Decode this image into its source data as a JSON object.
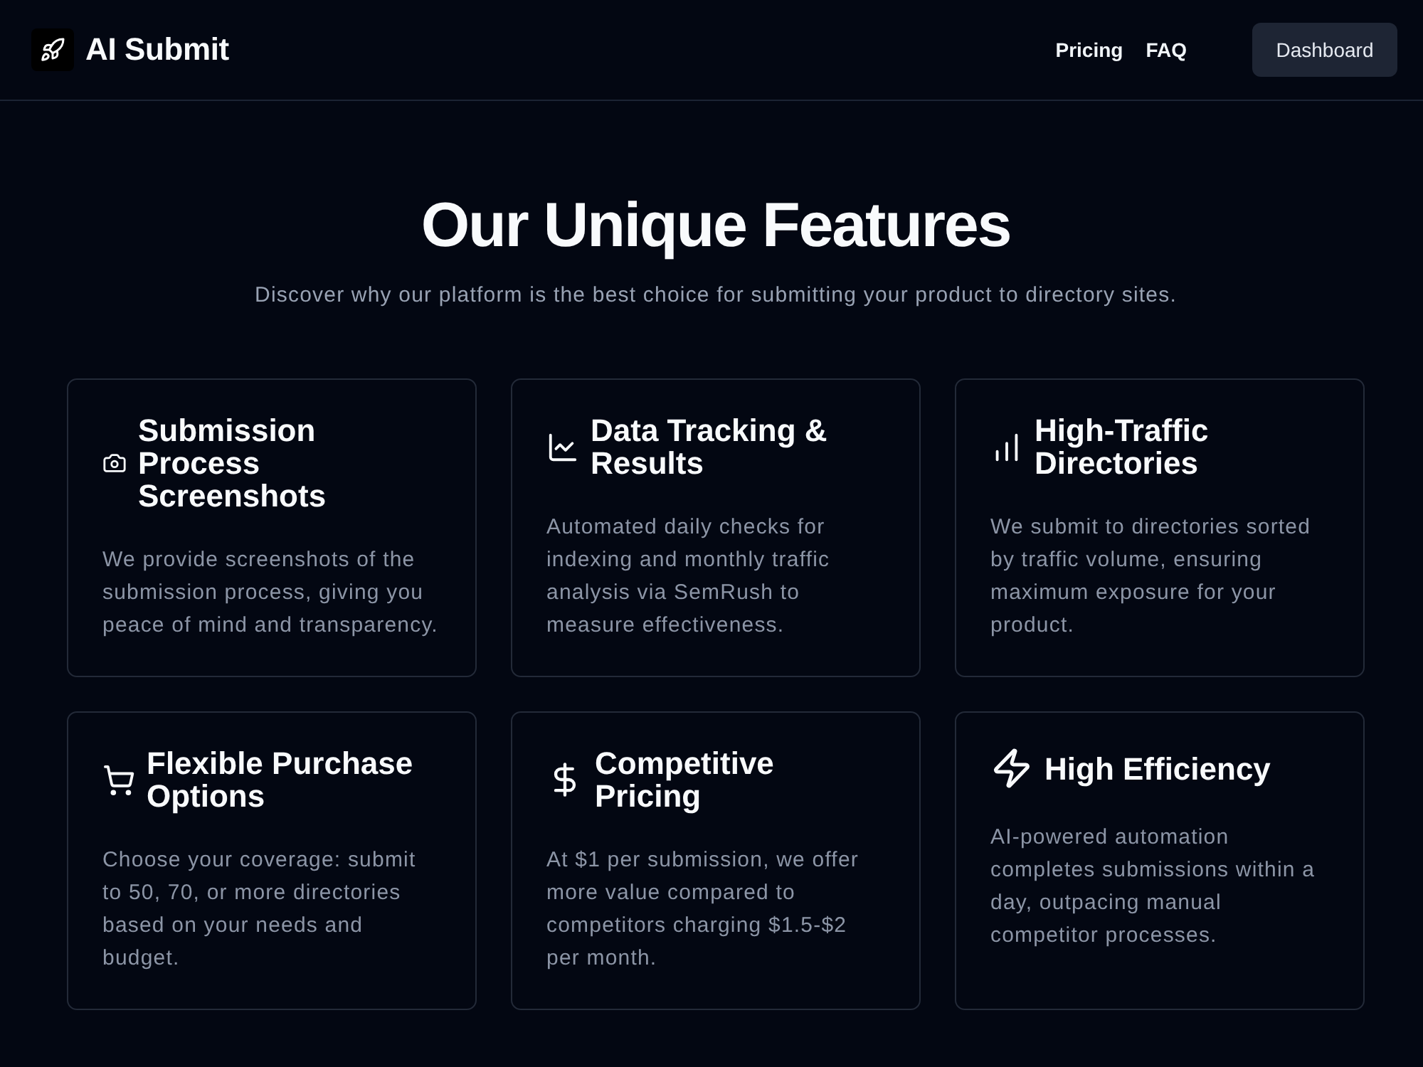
{
  "header": {
    "brand": "AI Submit",
    "nav_links": [
      "Pricing",
      "FAQ"
    ],
    "dashboard_button": "Dashboard"
  },
  "hero": {
    "title": "Our Unique Features",
    "subtitle": "Discover why our platform is the best choice for submitting your product to directory sites."
  },
  "features": [
    {
      "title": "Submission Process Screenshots",
      "description": "We provide screenshots of the submission process, giving you peace of mind and transparency."
    },
    {
      "title": "Data Tracking & Results",
      "description": "Automated daily checks for indexing and monthly traffic analysis via SemRush to measure effectiveness."
    },
    {
      "title": "High-Traffic Directories",
      "description": "We submit to directories sorted by traffic volume, ensuring maximum exposure for your product."
    },
    {
      "title": "Flexible Purchase Options",
      "description": "Choose your coverage: submit to 50, 70, or more directories based on your needs and budget."
    },
    {
      "title": "Competitive Pricing",
      "description": "At $1 per submission, we offer more value compared to competitors charging $1.5-$2 per month."
    },
    {
      "title": "High Efficiency",
      "description": "AI-powered automation completes submissions within a day, outpacing manual competitor processes."
    }
  ]
}
